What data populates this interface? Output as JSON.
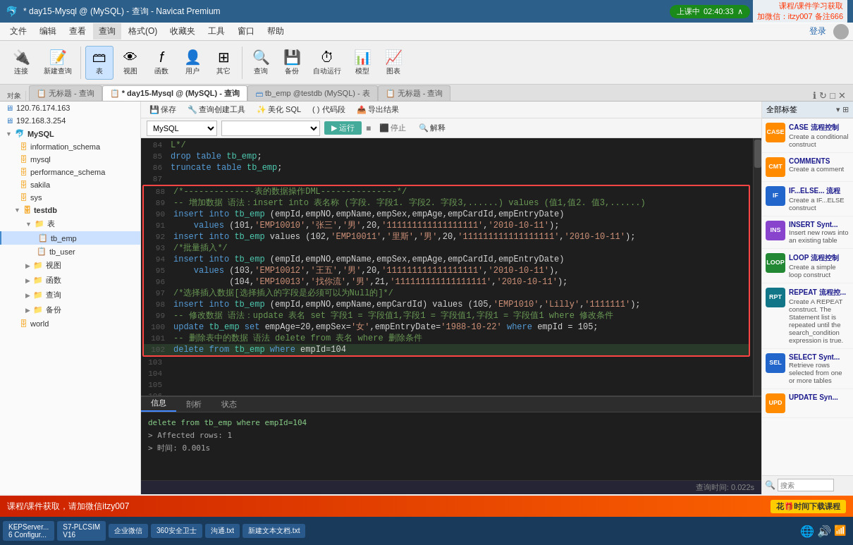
{
  "titlebar": {
    "title": "* day15-Mysql @ (MySQL) - 查询 - Navicat Premium",
    "tabs": [
      "* day15-Mysql @ (MySQL) - 查询"
    ]
  },
  "timer": {
    "label": "上课中",
    "time": "02:40:33"
  },
  "top_right_ad": {
    "line1": "课程/课件学习获取",
    "line2": "加微信：itzy007  备注666"
  },
  "menubar": {
    "items": [
      "文件",
      "编辑",
      "查看",
      "查询",
      "格式(O)",
      "收藏夹",
      "工具",
      "窗口",
      "帮助"
    ]
  },
  "toolbar": {
    "items": [
      {
        "label": "连接",
        "icon": "🔌"
      },
      {
        "label": "新建查询",
        "icon": "📄"
      },
      {
        "label": "表",
        "icon": "🗂"
      },
      {
        "label": "视图",
        "icon": "👁"
      },
      {
        "label": "函数",
        "icon": "ƒ"
      },
      {
        "label": "用户",
        "icon": "👤"
      },
      {
        "label": "其它",
        "icon": "⊞"
      },
      {
        "label": "查询",
        "icon": "🔍"
      },
      {
        "label": "备份",
        "icon": "💾"
      },
      {
        "label": "自动运行",
        "icon": "⏱"
      },
      {
        "label": "模型",
        "icon": "📊"
      },
      {
        "label": "图表",
        "icon": "📈"
      }
    ]
  },
  "nav_tabs": [
    {
      "label": "120.76.174.163",
      "active": false
    },
    {
      "label": "无标题 - 查询",
      "active": false
    },
    {
      "label": "* day15-Mysql @ (MySQL) - 查询",
      "active": true
    },
    {
      "label": "tb_emp @testdb (MySQL) - 表",
      "active": false
    },
    {
      "label": "无标题 - 查询",
      "active": false
    }
  ],
  "query_toolbar": {
    "save": "保存",
    "builder": "查询创建工具",
    "beautify": "美化 SQL",
    "snippet": "( ) 代码段",
    "export": "导出结果"
  },
  "query_toolbar2": {
    "db": "MySQL",
    "table": "",
    "run": "运行",
    "stop": "停止",
    "explain": "解释"
  },
  "sidebar": {
    "connections": [
      {
        "label": "120.76.174.163",
        "type": "server"
      },
      {
        "label": "192.168.3.254",
        "type": "server"
      },
      {
        "label": "MySQL",
        "type": "db-root",
        "children": [
          {
            "label": "information_schema",
            "type": "db"
          },
          {
            "label": "mysql",
            "type": "db"
          },
          {
            "label": "performance_schema",
            "type": "db"
          },
          {
            "label": "sakila",
            "type": "db"
          },
          {
            "label": "sys",
            "type": "db"
          },
          {
            "label": "testdb",
            "type": "db",
            "expanded": true,
            "children": [
              {
                "label": "表",
                "type": "folder",
                "expanded": true,
                "children": [
                  {
                    "label": "tb_emp",
                    "type": "table",
                    "selected": true
                  },
                  {
                    "label": "tb_user",
                    "type": "table"
                  }
                ]
              },
              {
                "label": "视图",
                "type": "folder"
              },
              {
                "label": "函数",
                "type": "folder"
              },
              {
                "label": "查询",
                "type": "folder"
              },
              {
                "label": "备份",
                "type": "folder"
              }
            ]
          },
          {
            "label": "world",
            "type": "db"
          }
        ]
      }
    ]
  },
  "code": {
    "lines": [
      {
        "num": "84",
        "content": "L*/",
        "type": "normal"
      },
      {
        "num": "85",
        "content": "drop table tb_emp;",
        "type": "normal"
      },
      {
        "num": "86",
        "content": "truncate table tb_emp;",
        "type": "normal"
      },
      {
        "num": "87",
        "content": "",
        "type": "normal"
      },
      {
        "num": "88",
        "content": "/*--------------表的数据操作DML---------------*/",
        "type": "comment"
      },
      {
        "num": "89",
        "content": "-- 增加数据 语法：insert into 表名称 (字段. 字段1. 字段2. 字段3,......) values (值1,值2. 值3,......);",
        "type": "comment"
      },
      {
        "num": "90",
        "content": "insert into tb_emp (empId,empNO,empName,empSex,empAge,empCardId,empEntryDate)",
        "type": "insert"
      },
      {
        "num": "91",
        "content": "    values (101,'EMP10010','张三','男',20,'111111111111111111','2010-10-11');",
        "type": "values"
      },
      {
        "num": "92",
        "content": "insert into tb_emp values (102,'EMP10011','里斯','男',20,'111111111111111111','2010-10-11');",
        "type": "insert"
      },
      {
        "num": "93",
        "content": "/*批量插入*/",
        "type": "comment"
      },
      {
        "num": "94",
        "content": "insert into tb_emp (empId,empNO,empName,empSex,empAge,empCardId,empEntryDate)",
        "type": "insert"
      },
      {
        "num": "95",
        "content": "    values (103,'EMP10012','王五','男',20,'111111111111111111','2010-10-11'),",
        "type": "values"
      },
      {
        "num": "96",
        "content": "           (104,'EMP10013','找你流','男',21,'111111111111111111','2010-10-11');",
        "type": "values"
      },
      {
        "num": "97",
        "content": "/*选择插入数据[选择插入的字段是必须可以为Null的]*/",
        "type": "comment"
      },
      {
        "num": "98",
        "content": "insert into tb_emp (empId,empNO,empName,empCardId) values (105,'EMP1010','Lilly','1111111');",
        "type": "insert"
      },
      {
        "num": "99",
        "content": "-- 修改数据 语法：update 表名 set 字段1 = 字段值1,字段1 = 字段值1,字段1 = 字段值1 where 修改条件",
        "type": "comment"
      },
      {
        "num": "100",
        "content": "update tb_emp set empAge=20,empSex='女',empEntryDate='1988-10-22' where empId = 105;",
        "type": "update"
      },
      {
        "num": "101",
        "content": "-- 删除表中的数据 语法 delete from 表名 where 删除条件",
        "type": "comment"
      },
      {
        "num": "102",
        "content": "delete from tb_emp where empId=104",
        "type": "delete"
      },
      {
        "num": "103",
        "content": "",
        "type": "normal"
      },
      {
        "num": "104",
        "content": "",
        "type": "normal"
      },
      {
        "num": "105",
        "content": "",
        "type": "normal"
      },
      {
        "num": "106",
        "content": "",
        "type": "normal"
      }
    ]
  },
  "bottom_tabs": [
    "信息",
    "剖析",
    "状态"
  ],
  "bottom_content": [
    "delete from tb_emp where empId=104",
    "> Affected rows: 1",
    "> 时间: 0.001s"
  ],
  "status_bar": {
    "query_time": "查询时间: 0.022s"
  },
  "right_panel": {
    "header": "全部标签",
    "items": [
      {
        "icon": "CASE",
        "icon_color": "orange",
        "title": "CASE 流程控制",
        "desc": "Create a conditional construct"
      },
      {
        "icon": "CMT",
        "icon_color": "orange",
        "title": "COMMENTS",
        "desc": "Create a comment"
      },
      {
        "icon": "IF",
        "icon_color": "blue",
        "title": "IF...ELSE... 流程",
        "desc": "Create a IF...ELSE construct"
      },
      {
        "icon": "INS",
        "icon_color": "purple",
        "title": "INSERT Synt...",
        "desc": "Insert new rows into an existing table"
      },
      {
        "icon": "LOOP",
        "icon_color": "green",
        "title": "LOOP 流程控制",
        "desc": "Create a simple loop construct"
      },
      {
        "icon": "RPT",
        "icon_color": "teal",
        "title": "REPEAT 流程控...",
        "desc": "Create A REPEAT construct. The Statement list is repeated until the search_condition expression is true."
      },
      {
        "icon": "SEL",
        "icon_color": "blue",
        "title": "SELECT Synt...",
        "desc": "Retrieve rows selected from one or more tables"
      },
      {
        "icon": "UPD",
        "icon_color": "orange",
        "title": "UPDATE Syn...",
        "desc": ""
      }
    ],
    "search_placeholder": "搜索"
  },
  "taskbar": {
    "items": [
      {
        "label": "KEPServer... 6 Configur..."
      },
      {
        "label": "S7-PLCSIM V16"
      },
      {
        "label": "企业微信"
      },
      {
        "label": "360安全卫士"
      },
      {
        "label": "沟通.txt"
      },
      {
        "label": "新建文本文档.txt"
      }
    ]
  },
  "notification": {
    "text": "课程/课件获取，请加微信itzy007",
    "right_text": "花时间下载课程"
  },
  "login": "登录"
}
